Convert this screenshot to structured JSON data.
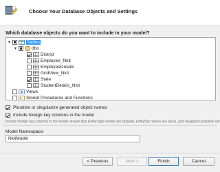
{
  "header": {
    "title": "Choose Your Database Objects and Settings"
  },
  "question": "Which database objects do you want to include in your model?",
  "tree": {
    "tables": {
      "label": "Tables",
      "state": "partial",
      "expanded": true,
      "selected": true
    },
    "dbo": {
      "label": "dbo",
      "state": "partial",
      "expanded": true
    },
    "items": [
      {
        "label": "District",
        "checked": true
      },
      {
        "label": "Employee_Nkit",
        "checked": false
      },
      {
        "label": "EmployeeDetails",
        "checked": false
      },
      {
        "label": "GridView_Nkit",
        "checked": false
      },
      {
        "label": "State",
        "checked": true
      },
      {
        "label": "StudentDetails_Nkit",
        "checked": false
      }
    ],
    "views": {
      "label": "Views",
      "checked": false
    },
    "procs": {
      "label": "Stored Procedures and Functions",
      "checked": false
    }
  },
  "options": {
    "pluralize": {
      "label": "Pluralize or singularize generated object names",
      "checked": true
    },
    "foreign_keys": {
      "label": "Include foreign key columns in the model",
      "checked": true
    }
  },
  "hint_text": "Include foreign key columns in the model: ensure that EntityType names are singular, EntitySet names are plural, and navigation property names are plural.",
  "namespace": {
    "label": "Model Namespace:",
    "value": "NkitModel"
  },
  "buttons": {
    "previous": "< Previous",
    "next": "Next >",
    "finish": "Finish",
    "cancel": "Cancel"
  },
  "colors": {
    "selection": "#3399ff",
    "header_bg": "#ffffff",
    "body_bg": "#f0f0f0"
  }
}
